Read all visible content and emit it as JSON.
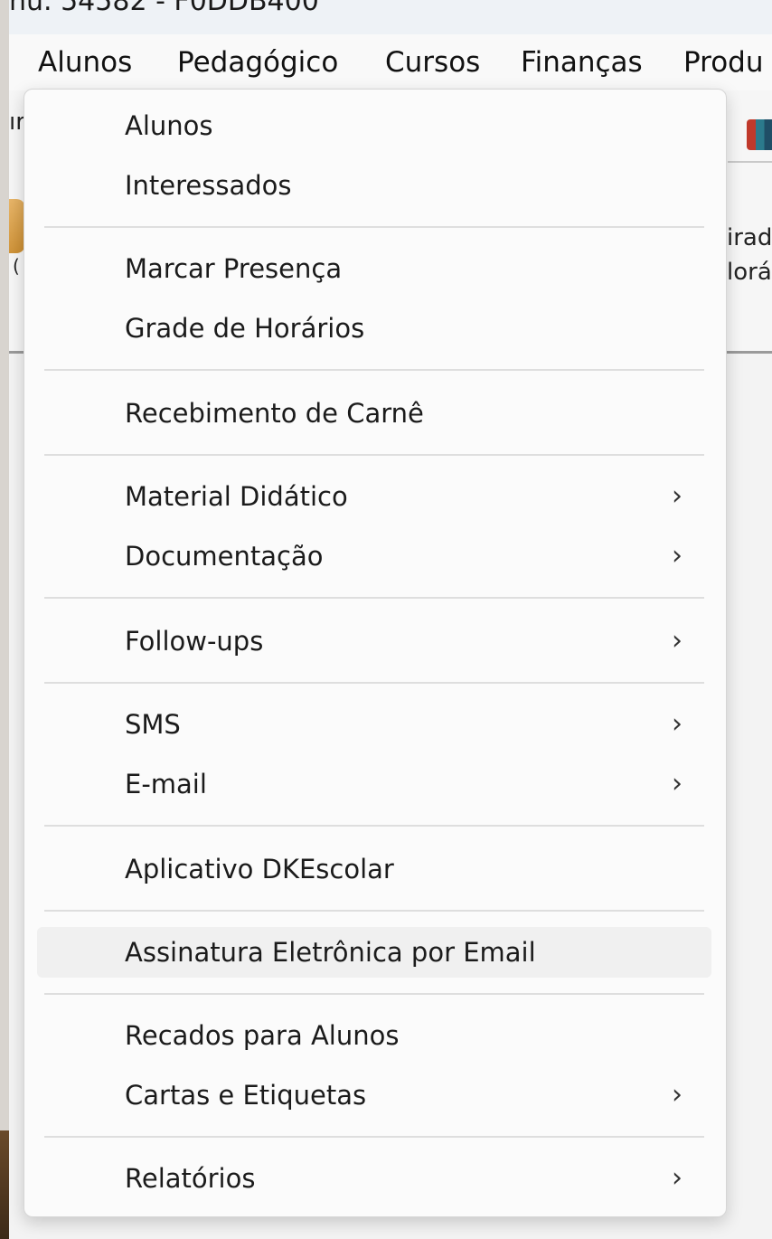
{
  "window": {
    "title_fragment": "nu. 54582 - F0DDB400"
  },
  "menubar": {
    "items": [
      "Alunos",
      "Pedagógico",
      "Cursos",
      "Finanças",
      "Produ"
    ]
  },
  "toolbar": {
    "left_fragment": "ır",
    "right_line1": "irad",
    "right_line2": "lorá",
    "left_line2": "("
  },
  "menu": {
    "items": [
      {
        "label": "Alunos",
        "submenu": false
      },
      {
        "label": "Interessados",
        "submenu": false
      },
      {
        "label": "Marcar Presença",
        "submenu": false
      },
      {
        "label": "Grade de Horários",
        "submenu": false
      },
      {
        "label": "Recebimento de Carnê",
        "submenu": false
      },
      {
        "label": "Material Didático",
        "submenu": true
      },
      {
        "label": "Documentação",
        "submenu": true
      },
      {
        "label": "Follow-ups",
        "submenu": true
      },
      {
        "label": "SMS",
        "submenu": true
      },
      {
        "label": "E-mail",
        "submenu": true
      },
      {
        "label": "Aplicativo DKEscolar",
        "submenu": false
      },
      {
        "label": "Assinatura Eletrônica por Email",
        "submenu": false,
        "highlighted": true
      },
      {
        "label": "Recados para Alunos",
        "submenu": false
      },
      {
        "label": "Cartas e Etiquetas",
        "submenu": true
      },
      {
        "label": "Relatórios",
        "submenu": true
      }
    ],
    "chevron": "›"
  }
}
